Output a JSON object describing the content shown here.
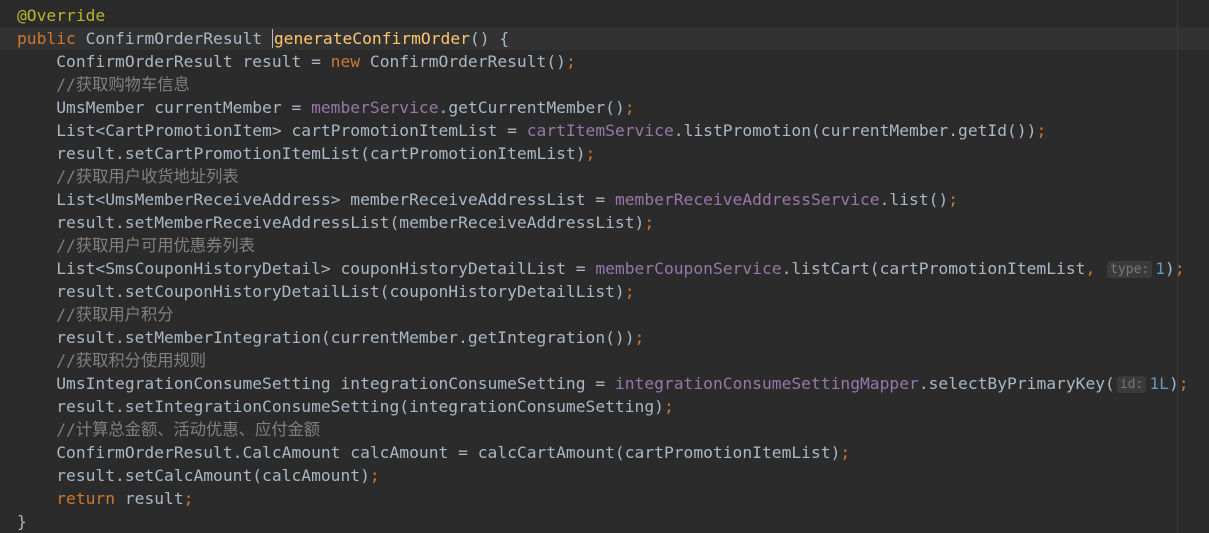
{
  "editor": {
    "colors": {
      "background": "#2b2b2b",
      "keyword": "#cc7832",
      "annotation": "#bbb529",
      "field": "#9876aa",
      "method_declaration": "#ffc66d",
      "number": "#6897bb",
      "comment": "#808080",
      "text": "#a9b7c6"
    },
    "lines": [
      [
        {
          "t": "@Override",
          "c": "ann"
        }
      ],
      [
        {
          "t": "public",
          "c": "kw"
        },
        {
          "t": " ConfirmOrderResult "
        },
        {
          "caret": true
        },
        {
          "t": "generateConfirmOrder",
          "c": "meth"
        },
        {
          "t": "() {"
        }
      ],
      [
        {
          "t": "    ConfirmOrderResult result = "
        },
        {
          "t": "new",
          "c": "kw"
        },
        {
          "t": " ConfirmOrderResult()"
        },
        {
          "t": ";",
          "c": "kw"
        }
      ],
      [
        {
          "t": "    //获取购物车信息",
          "c": "cmt"
        }
      ],
      [
        {
          "t": "    UmsMember currentMember = "
        },
        {
          "t": "memberService",
          "c": "fld"
        },
        {
          "t": ".getCurrentMember()"
        },
        {
          "t": ";",
          "c": "kw"
        }
      ],
      [
        {
          "t": "    List<CartPromotionItem> cartPromotionItemList = "
        },
        {
          "t": "cartItemService",
          "c": "fld"
        },
        {
          "t": ".listPromotion(currentMember.getId())"
        },
        {
          "t": ";",
          "c": "kw"
        }
      ],
      [
        {
          "t": "    result.setCartPromotionItemList(cartPromotionItemList)"
        },
        {
          "t": ";",
          "c": "kw"
        }
      ],
      [
        {
          "t": "    //获取用户收货地址列表",
          "c": "cmt"
        }
      ],
      [
        {
          "t": "    List<UmsMemberReceiveAddress> memberReceiveAddressList = "
        },
        {
          "t": "memberReceiveAddressService",
          "c": "fld"
        },
        {
          "t": ".list()"
        },
        {
          "t": ";",
          "c": "kw"
        }
      ],
      [
        {
          "t": "    result.setMemberReceiveAddressList(memberReceiveAddressList)"
        },
        {
          "t": ";",
          "c": "kw"
        }
      ],
      [
        {
          "t": "    //获取用户可用优惠券列表",
          "c": "cmt"
        }
      ],
      [
        {
          "t": "    List<SmsCouponHistoryDetail> couponHistoryDetailList = "
        },
        {
          "t": "memberCouponService",
          "c": "fld"
        },
        {
          "t": ".listCart(cartPromotionItemList"
        },
        {
          "t": ",",
          "c": "kw"
        },
        {
          "t": " "
        },
        {
          "hint": "type:"
        },
        {
          "t": "1",
          "c": "num"
        },
        {
          "t": ")"
        },
        {
          "t": ";",
          "c": "kw"
        }
      ],
      [
        {
          "t": "    result.setCouponHistoryDetailList(couponHistoryDetailList)"
        },
        {
          "t": ";",
          "c": "kw"
        }
      ],
      [
        {
          "t": "    //获取用户积分",
          "c": "cmt"
        }
      ],
      [
        {
          "t": "    result.setMemberIntegration(currentMember.getIntegration())"
        },
        {
          "t": ";",
          "c": "kw"
        }
      ],
      [
        {
          "t": "    //获取积分使用规则",
          "c": "cmt"
        }
      ],
      [
        {
          "t": "    UmsIntegrationConsumeSetting integrationConsumeSetting = "
        },
        {
          "t": "integrationConsumeSettingMapper",
          "c": "fld"
        },
        {
          "t": ".selectByPrimaryKey("
        },
        {
          "hint": "id:"
        },
        {
          "t": "1L",
          "c": "num"
        },
        {
          "t": ")"
        },
        {
          "t": ";",
          "c": "kw"
        }
      ],
      [
        {
          "t": "    result.setIntegrationConsumeSetting(integrationConsumeSetting)"
        },
        {
          "t": ";",
          "c": "kw"
        }
      ],
      [
        {
          "t": "    //计算总金额、活动优惠、应付金额",
          "c": "cmt"
        }
      ],
      [
        {
          "t": "    ConfirmOrderResult.CalcAmount calcAmount = calcCartAmount(cartPromotionItemList)"
        },
        {
          "t": ";",
          "c": "kw"
        }
      ],
      [
        {
          "t": "    result.setCalcAmount(calcAmount)"
        },
        {
          "t": ";",
          "c": "kw"
        }
      ],
      [
        {
          "t": "    "
        },
        {
          "t": "return",
          "c": "kw"
        },
        {
          "t": " result"
        },
        {
          "t": ";",
          "c": "kw"
        }
      ],
      [
        {
          "t": "}"
        }
      ]
    ]
  }
}
